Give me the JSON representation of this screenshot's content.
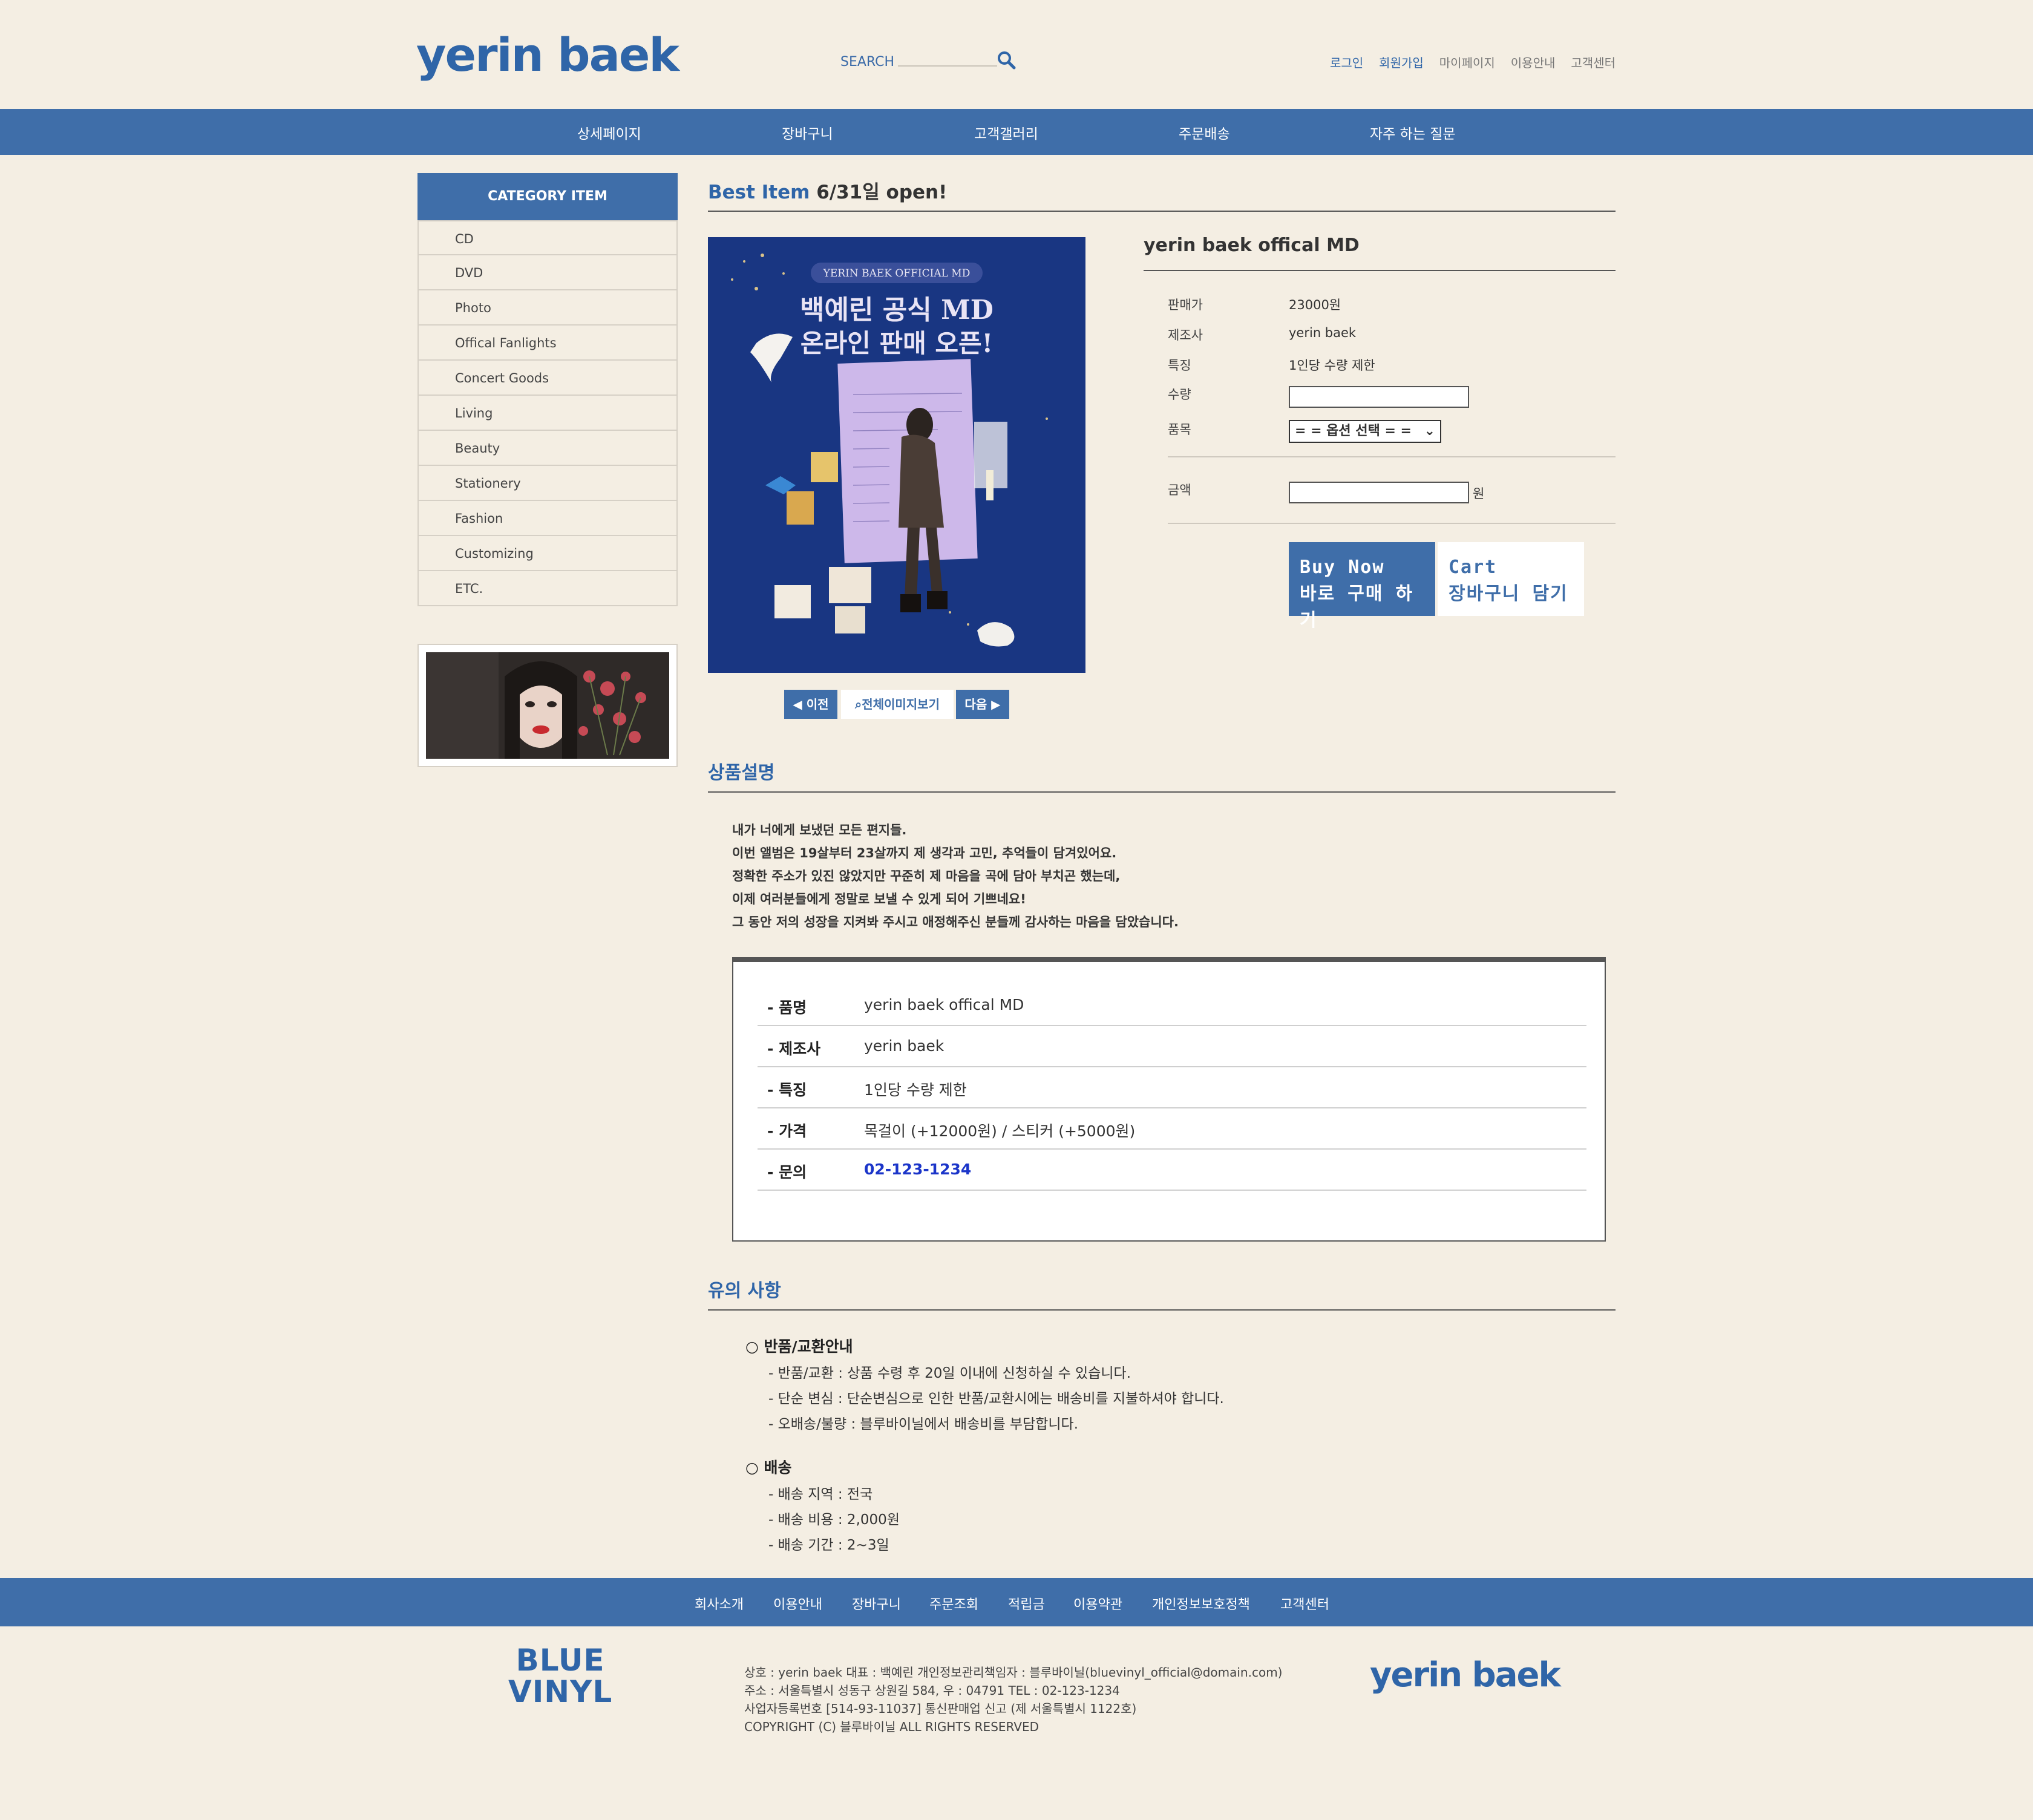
{
  "header": {
    "logo": "yerin baek",
    "search_label": "SEARCH",
    "links": [
      "로그인",
      "회원가입",
      "마이페이지",
      "이용안내",
      "고객센터"
    ]
  },
  "nav": [
    "상세페이지",
    "장바구니",
    "고객갤러리",
    "주문배송",
    "자주 하는 질문"
  ],
  "sidebar": {
    "category_title": "CATEGORY ITEM",
    "items": [
      "CD",
      "DVD",
      "Photo",
      "Offical Fanlights",
      "Concert Goods",
      "Living",
      "Beauty",
      "Stationery",
      "Fashion",
      "Customizing",
      "ETC."
    ]
  },
  "main": {
    "best_item_label": "Best Item",
    "best_item_suffix": "6/31일 open!",
    "poster": {
      "badge": "YERIN BAEK OFFICIAL MD",
      "line1": "백예린 공식 MD",
      "line2": "온라인 판매 오픈!"
    },
    "pager": {
      "prev": "◀ 이전",
      "view_all": "전체이미지보기",
      "next": "다음 ▶"
    },
    "product": {
      "title": "yerin baek offical MD",
      "price_label": "판매가",
      "price": "23000원",
      "maker_label": "제조사",
      "maker": "yerin baek",
      "feature_label": "특징",
      "feature": "1인당 수량 제한",
      "qty_label": "수량",
      "item_label": "품목",
      "option_selected": "= = 옵션 선택 = =",
      "amount_label": "금액",
      "won": "원",
      "buy_line1": "Buy Now",
      "buy_line2": "바로 구매 하기",
      "cart_line1": "Cart",
      "cart_line2": "장바구니 담기"
    },
    "description": {
      "title": "상품설명",
      "lines": [
        "내가 너에게 보냈던 모든 편지들.",
        "이번 앨범은 19살부터 23살까지 제 생각과 고민, 추억들이 담겨있어요.",
        "정확한 주소가 있진 않았지만 꾸준히 제 마음을 곡에 담아 부치곤 했는데,",
        "이제 여러분들에게 정말로 보낼 수 있게 되어 기쁘네요!",
        "그 동안 저의 성장을 지켜봐 주시고 애정해주신 분들께 감사하는 마음을 담았습니다."
      ]
    },
    "spec": [
      {
        "key": "- 품명",
        "value": "yerin baek offical MD"
      },
      {
        "key": "- 제조사",
        "value": "yerin baek"
      },
      {
        "key": "- 특징",
        "value": "1인당 수량 제한"
      },
      {
        "key": "- 가격",
        "value": "목걸이 (+12000원) / 스티커 (+5000원)"
      },
      {
        "key": "- 문의",
        "value": "02-123-1234"
      }
    ],
    "notice": {
      "title": "유의 사항",
      "return_head": "○ 반품/교환안내",
      "return_lines": [
        "- 반품/교환 : 상품 수령 후 20일 이내에 신청하실 수 있습니다.",
        "- 단순 변심 : 단순변심으로 인한 반품/교환시에는 배송비를 지불하셔야 합니다.",
        "- 오배송/불량 : 블루바이닐에서 배송비를 부담합니다."
      ],
      "ship_head": "○ 배송",
      "ship_lines": [
        "- 배송 지역 : 전국",
        "- 배송 비용 : 2,000원",
        "- 배송 기간 : 2~3일"
      ]
    }
  },
  "footer": {
    "nav": [
      "회사소개",
      "이용안내",
      "장바구니",
      "주문조회",
      "적립금",
      "이용약관",
      "개인정보보호정책",
      "고객센터"
    ],
    "logo_left_1": "BLUE",
    "logo_left_2": "VINYL",
    "lines": [
      "상호 : yerin baek 대표 : 백예린 개인정보관리책임자 : 블루바이닐(bluevinyl_official@domain.com)",
      "주소 : 서울특별시 성동구 상원길 584, 우 : 04791 TEL : 02-123-1234",
      "사업자등록번호 [514-93-11037] 통신판매업 신고 (제 서울특별시 1122호)",
      "COPYRIGHT (C) 블루바이닐 ALL RIGHTS RESERVED"
    ],
    "logo_right": "yerin baek"
  },
  "colors": {
    "background": "#f4eee3",
    "brand_blue": "#3f6ea9",
    "logo_blue": "#2f65a8",
    "contact_link": "#1b35c9"
  }
}
